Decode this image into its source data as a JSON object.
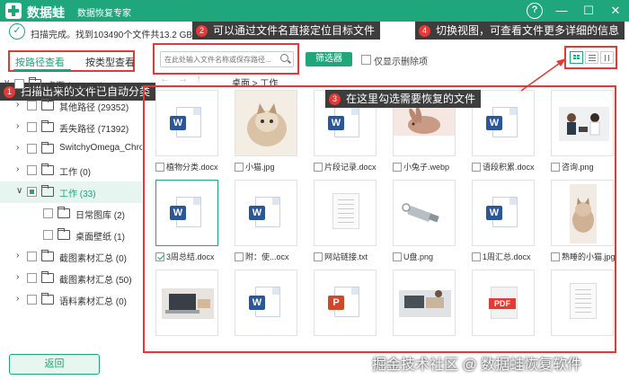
{
  "titlebar": {
    "brand": "数据蛙",
    "subtitle": "数据恢复专家",
    "help": "?",
    "minimize": "—",
    "maximize": "☐",
    "close": "✕"
  },
  "status": {
    "check": "✓",
    "text": "扫描完成。找到103490个文件共13.2 GB。"
  },
  "callouts": [
    {
      "num": "1",
      "text": "扫描出来的文件已自动分类"
    },
    {
      "num": "2",
      "text": "可以通过文件名直接定位目标文件"
    },
    {
      "num": "3",
      "text": "在这里勾选需要恢复的文件"
    },
    {
      "num": "4",
      "text": "切换视图，可查看文件更多详细的信息"
    }
  ],
  "sidebar": {
    "tab_path": "按路径查看",
    "tab_type": "按类型查看",
    "tree": [
      {
        "label": "桌面 (103490)",
        "arrow": "∨",
        "indent": 0
      },
      {
        "label": "其他路径 (29352)",
        "arrow": "›",
        "indent": 1
      },
      {
        "label": "丢失路径 (71392)",
        "arrow": "›",
        "indent": 1
      },
      {
        "label": "SwitchyOmega_Chromium",
        "arrow": "›",
        "indent": 1
      },
      {
        "label": "工作 (0)",
        "arrow": "›",
        "indent": 1
      },
      {
        "label": "工作 (33)",
        "arrow": "∨",
        "indent": 1,
        "active": true
      },
      {
        "label": "日常图库 (2)",
        "arrow": "",
        "indent": 2
      },
      {
        "label": "桌面壁纸 (1)",
        "arrow": "",
        "indent": 2
      },
      {
        "label": "截图素材汇总 (0)",
        "arrow": "›",
        "indent": 1
      },
      {
        "label": "截图素材汇总 (50)",
        "arrow": "›",
        "indent": 1
      },
      {
        "label": "语料素材汇总 (0)",
        "arrow": "›",
        "indent": 1
      }
    ],
    "back_label": "返回"
  },
  "toolbar": {
    "search_placeholder": "在此处输入文件名称或保存路径...",
    "filter_label": "筛选器",
    "deleted_only_label": "仅显示删除项",
    "nav_back": "←",
    "nav_forward": "→",
    "nav_up": "↑",
    "breadcrumb": "桌面 > 工作"
  },
  "files": [
    {
      "name": "植物分类.docx",
      "type": "word"
    },
    {
      "name": "小猫.jpg",
      "type": "photo-cat"
    },
    {
      "name": "片段记录.docx",
      "type": "word"
    },
    {
      "name": "小兔子.webp",
      "type": "photo-rabbit"
    },
    {
      "name": "语段积累.docx",
      "type": "word"
    },
    {
      "name": "咨询.png",
      "type": "photo-office"
    },
    {
      "name": "3周总结.docx",
      "type": "word",
      "selected": true,
      "checked": true
    },
    {
      "name": "附：使...ocx",
      "type": "word"
    },
    {
      "name": "网站链接.txt",
      "type": "txt"
    },
    {
      "name": "U盘.png",
      "type": "photo-usb"
    },
    {
      "name": "1周汇总.docx",
      "type": "word"
    },
    {
      "name": "熟睡的小猫.jpg",
      "type": "photo-kitten"
    },
    {
      "name": "",
      "type": "photo-laptop"
    },
    {
      "name": "",
      "type": "word"
    },
    {
      "name": "",
      "type": "ppt"
    },
    {
      "name": "",
      "type": "photo-desk"
    },
    {
      "name": "",
      "type": "pdf"
    },
    {
      "name": "",
      "type": "txt"
    }
  ],
  "badges": {
    "word": "W",
    "ppt": "P",
    "pdf": "PDF"
  },
  "watermark": "掘金技术社区 @ 数据蛙恢复软件",
  "colors": {
    "brand": "#1fa67a",
    "highlight": "#e53935",
    "callout_bg": "#3d3d3d"
  }
}
